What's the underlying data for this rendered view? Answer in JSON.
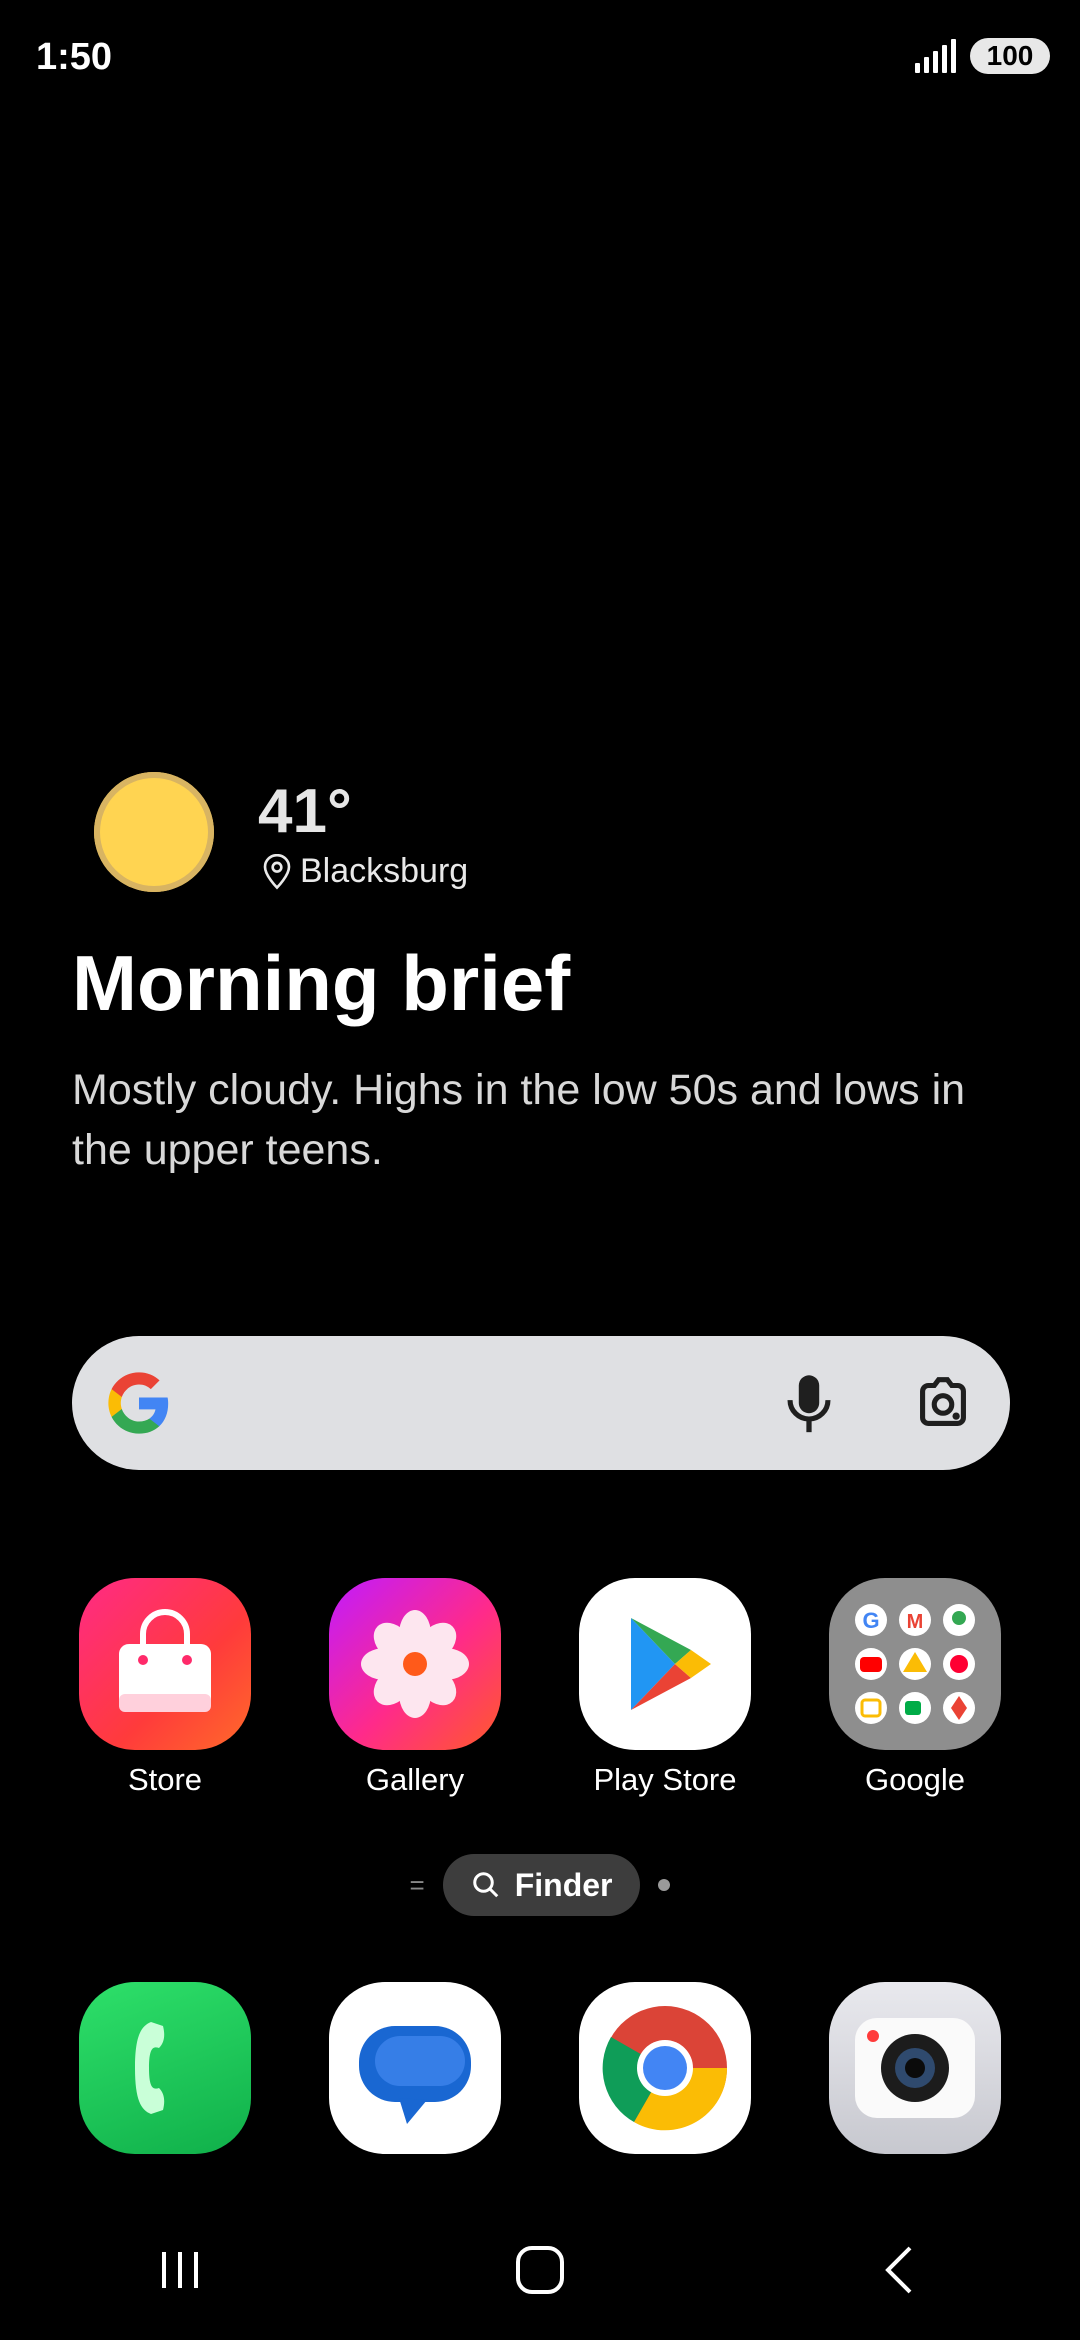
{
  "status": {
    "time": "1:50",
    "battery": "100"
  },
  "weather": {
    "temperature": "41°",
    "location": "Blacksburg"
  },
  "brief": {
    "title": "Morning brief",
    "text": "Mostly cloudy. Highs in the low 50s and lows in the upper teens."
  },
  "search": {},
  "apps": [
    {
      "label": "Store",
      "icon": "store-icon"
    },
    {
      "label": "Gallery",
      "icon": "gallery-icon"
    },
    {
      "label": "Play Store",
      "icon": "play-store-icon"
    },
    {
      "label": "Google",
      "icon": "google-folder-icon"
    }
  ],
  "finder": {
    "label": "Finder"
  },
  "dock": [
    {
      "icon": "phone-icon"
    },
    {
      "icon": "messages-icon"
    },
    {
      "icon": "chrome-icon"
    },
    {
      "icon": "camera-icon"
    }
  ],
  "colors": {
    "background": "#000000",
    "sun": "#ffd451",
    "search_bg": "#dfe0e3",
    "finder_bg": "#3d3d3d"
  }
}
